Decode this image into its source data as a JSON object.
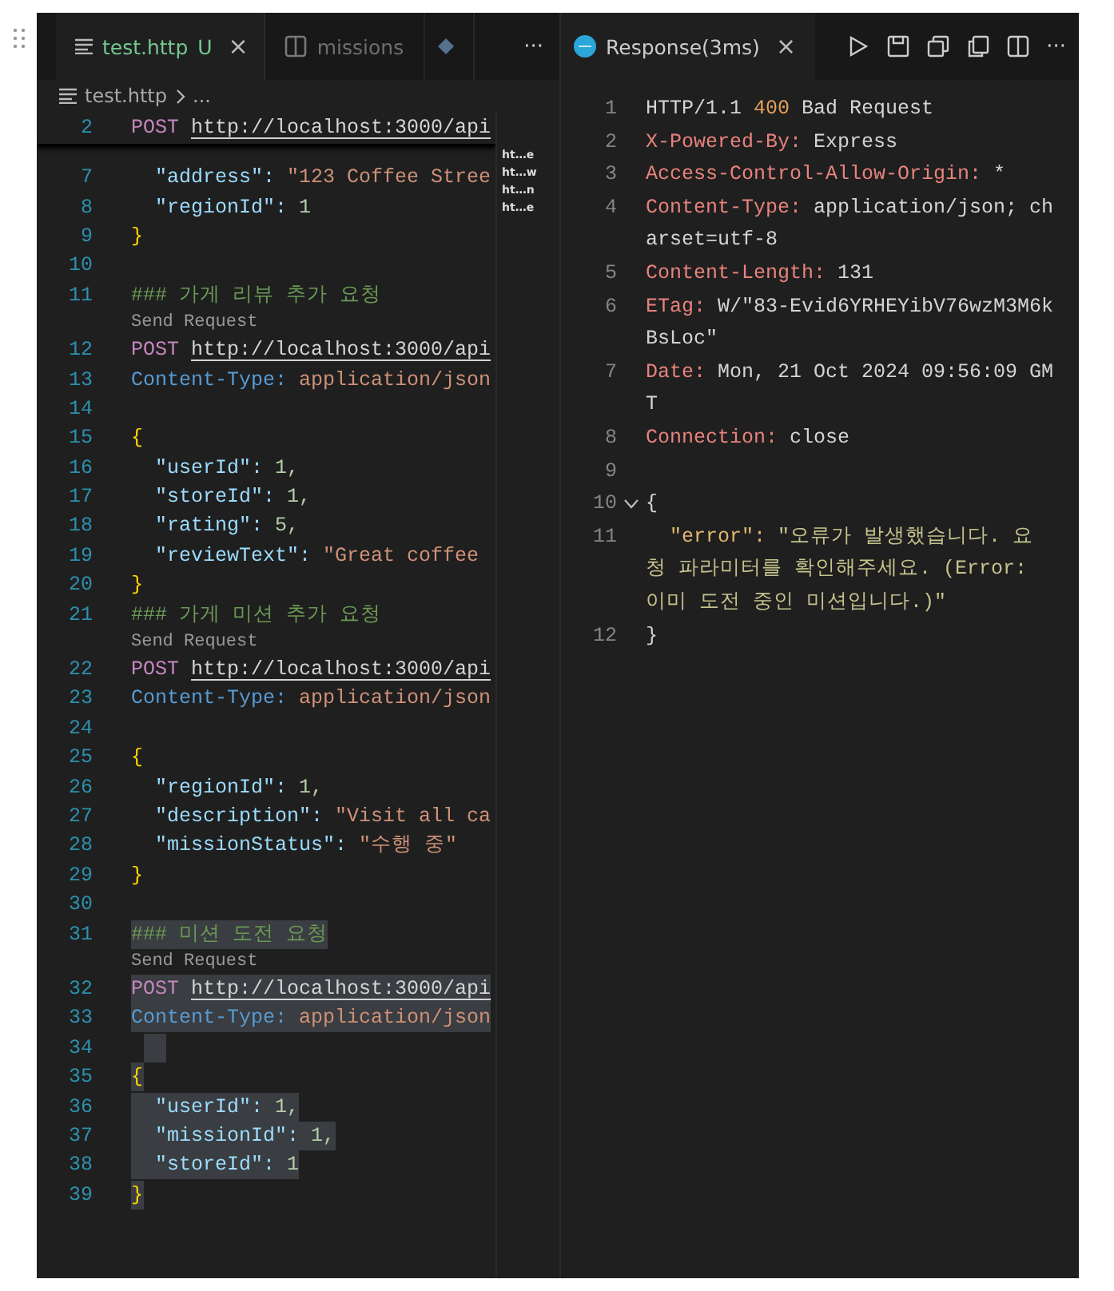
{
  "editor": {
    "tabs": [
      {
        "kind": "file",
        "label": "test.http",
        "status": "U",
        "close": "×",
        "selected": true
      },
      {
        "kind": "preview",
        "label": "missions",
        "selected": false
      },
      {
        "kind": "extension",
        "selected": false
      }
    ],
    "more": "···",
    "breadcrumb": [
      "test.http",
      "..."
    ],
    "sticky": {
      "num": "2",
      "kind": "request",
      "method": "POST",
      "url": "http://localhost:3000/api"
    },
    "lines": [
      {
        "num": "7",
        "kind": "strprop",
        "key": "\"address\":",
        "value": "\"123 Coffee Stree",
        "selected": false
      },
      {
        "num": "8",
        "kind": "numprop",
        "key": "\"regionId\":",
        "value": "1",
        "selected": false
      },
      {
        "num": "9",
        "kind": "brace",
        "text": "}",
        "selected": false
      },
      {
        "num": "10",
        "kind": "blank",
        "selected": false
      },
      {
        "num": "11",
        "kind": "comment",
        "text": "### 가게 리뷰 추가 요청",
        "selected": false
      },
      {
        "num": "12",
        "kind": "request",
        "lens": "Send Request",
        "method": "POST",
        "url": "http://localhost:3000/api",
        "selected": false
      },
      {
        "num": "13",
        "kind": "header",
        "name": "Content-Type:",
        "value": "application/json",
        "selected": false
      },
      {
        "num": "14",
        "kind": "blank",
        "selected": false
      },
      {
        "num": "15",
        "kind": "brace",
        "text": "{",
        "selected": false
      },
      {
        "num": "16",
        "kind": "numprop",
        "key": "\"userId\":",
        "value": "1,",
        "selected": false
      },
      {
        "num": "17",
        "kind": "numprop",
        "key": "\"storeId\":",
        "value": "1,",
        "selected": false
      },
      {
        "num": "18",
        "kind": "numprop",
        "key": "\"rating\":",
        "value": "5,",
        "selected": false
      },
      {
        "num": "19",
        "kind": "strprop",
        "key": "\"reviewText\":",
        "value": "\"Great coffee",
        "selected": false
      },
      {
        "num": "20",
        "kind": "brace",
        "text": "}",
        "selected": false
      },
      {
        "num": "21",
        "kind": "comment",
        "text": "### 가게 미션 추가 요청",
        "selected": false
      },
      {
        "num": "22",
        "kind": "request",
        "lens": "Send Request",
        "method": "POST",
        "url": "http://localhost:3000/api",
        "selected": false
      },
      {
        "num": "23",
        "kind": "header",
        "name": "Content-Type:",
        "value": "application/json",
        "selected": false
      },
      {
        "num": "24",
        "kind": "blank",
        "selected": false
      },
      {
        "num": "25",
        "kind": "brace",
        "text": "{",
        "selected": false
      },
      {
        "num": "26",
        "kind": "numprop",
        "key": "\"regionId\":",
        "value": "1,",
        "selected": false
      },
      {
        "num": "27",
        "kind": "strprop",
        "key": "\"description\":",
        "value": "\"Visit all ca",
        "selected": false
      },
      {
        "num": "28",
        "kind": "strprop",
        "key": "\"missionStatus\":",
        "value": "\"수행 중\"",
        "selected": false
      },
      {
        "num": "29",
        "kind": "brace",
        "text": "}",
        "selected": false
      },
      {
        "num": "30",
        "kind": "blank",
        "selected": false
      },
      {
        "num": "31",
        "kind": "comment",
        "text": "### 미션 도전 요청",
        "selected": true
      },
      {
        "num": "32",
        "kind": "request",
        "lens": "Send Request",
        "method": "POST",
        "url": "http://localhost:3000/api",
        "selected": true
      },
      {
        "num": "33",
        "kind": "header",
        "name": "Content-Type:",
        "value": "application/json",
        "selected": true
      },
      {
        "num": "34",
        "kind": "blank",
        "selected": true
      },
      {
        "num": "35",
        "kind": "brace",
        "text": "{",
        "selected": true
      },
      {
        "num": "36",
        "kind": "numprop",
        "key": "\"userId\":",
        "value": "1,",
        "selected": true
      },
      {
        "num": "37",
        "kind": "numprop",
        "key": "\"missionId\":",
        "value": "1,",
        "selected": true
      },
      {
        "num": "38",
        "kind": "numprop",
        "key": "\"storeId\":",
        "value": "1",
        "selected": true
      },
      {
        "num": "39",
        "kind": "brace",
        "text": "}",
        "selected": true
      }
    ],
    "minimap": [
      "ht…e",
      "ht…w",
      "ht…n",
      "ht…e"
    ]
  },
  "response": {
    "tab": {
      "label": "Response(3ms)",
      "close": "×",
      "selected": true
    },
    "more": "···",
    "lines": [
      {
        "num": "1",
        "kind": "status",
        "version": "HTTP/1.1",
        "code": "400",
        "reason": "Bad Request"
      },
      {
        "num": "2",
        "kind": "header",
        "name": "X-Powered-By:",
        "value": "Express"
      },
      {
        "num": "3",
        "kind": "header",
        "name": "Access-Control-Allow-Origin:",
        "value": "*"
      },
      {
        "num": "4",
        "kind": "header",
        "name": "Content-Type:",
        "value": "application/json; ch",
        "continued": [
          "arset=utf-8"
        ]
      },
      {
        "num": "5",
        "kind": "header",
        "name": "Content-Length:",
        "value": "131"
      },
      {
        "num": "6",
        "kind": "header",
        "name": "ETag:",
        "value": "W/\"83-Evid6YRHEYibV76wzM3M6k",
        "continued": [
          "BsLoc\""
        ]
      },
      {
        "num": "7",
        "kind": "header",
        "name": "Date:",
        "value": "Mon, 21 Oct 2024 09:56:09 GM",
        "continued": [
          "T"
        ]
      },
      {
        "num": "8",
        "kind": "header",
        "name": "Connection:",
        "value": "close"
      },
      {
        "num": "9",
        "kind": "blank"
      },
      {
        "num": "10",
        "kind": "brace",
        "text": "{",
        "expanded": true
      },
      {
        "num": "11",
        "kind": "strprop",
        "key": "\"error\":",
        "value": "\"오류가 발생했습니다. 요",
        "continued": [
          "청 파라미터를 확인해주세요. (Error:",
          "이미 도전 중인 미션입니다.)\""
        ]
      },
      {
        "num": "12",
        "kind": "brace",
        "text": "}"
      }
    ]
  }
}
